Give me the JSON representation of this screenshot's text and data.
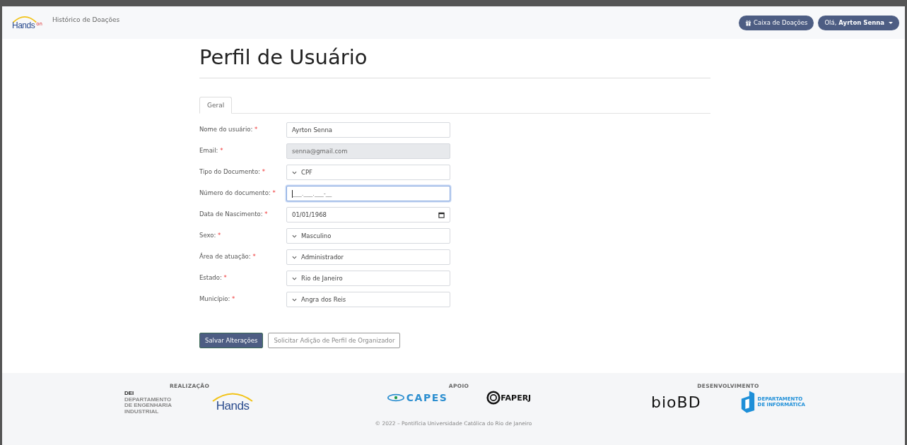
{
  "navbar": {
    "logo": {
      "text": "Hands",
      "sup": "on"
    },
    "links": [
      "Histórico de Doações"
    ],
    "donation_box_button": "Caixa de Doações",
    "user_menu": {
      "greeting": "Olá,",
      "name": "Ayrton Senna"
    }
  },
  "page_title": "Perfil de Usuário",
  "tabs": [
    {
      "label": "Geral",
      "selected": true
    }
  ],
  "form": {
    "required_mark": "*",
    "fields": [
      {
        "label": "Nome do usuário:",
        "kind": "text",
        "value": "Ayrton Senna",
        "disabled": false,
        "focused": false
      },
      {
        "label": "Email:",
        "kind": "text",
        "value": "senna@gmail.com",
        "disabled": true,
        "focused": false
      },
      {
        "label": "Tipo do Documento:",
        "kind": "select",
        "value": "CPF",
        "disabled": false,
        "focused": false
      },
      {
        "label": "Número do documento:",
        "kind": "text",
        "placeholder": "___.___.___-__",
        "disabled": false,
        "focused": true
      },
      {
        "label": "Data de Nascimento:",
        "kind": "date",
        "value": "01/01/1968",
        "disabled": false,
        "focused": false
      },
      {
        "label": "Sexo:",
        "kind": "select",
        "value": "Masculino",
        "disabled": false,
        "focused": false
      },
      {
        "label": "Área de atuação:",
        "kind": "select",
        "value": "Administrador",
        "disabled": false,
        "focused": false
      },
      {
        "label": "Estado:",
        "kind": "select",
        "value": "Rio de Janeiro",
        "disabled": false,
        "focused": false
      },
      {
        "label": "Município:",
        "kind": "select",
        "value": "Angra dos Reis",
        "disabled": false,
        "focused": false
      }
    ]
  },
  "buttons": [
    {
      "label": "Salvar Alterações",
      "kind": "primary"
    },
    {
      "label": "Solicitar Adição de Perfil de Organizador",
      "kind": "outline"
    }
  ],
  "footer": {
    "sections": [
      {
        "heading": "REALIZAÇÃO",
        "logos": [
          {
            "kind": "dei",
            "lines": [
              "DEI",
              "DEPARTAMENTO",
              "DE ENGENHARIA",
              "INDUSTRIAL"
            ]
          },
          {
            "kind": "hands",
            "lines": [
              "Hands"
            ]
          }
        ]
      },
      {
        "heading": "APOIO",
        "logos": [
          {
            "kind": "capes",
            "lines": [
              "CAPES"
            ]
          },
          {
            "kind": "faperj",
            "lines": [
              "FAPERJ"
            ]
          }
        ]
      },
      {
        "heading": "DESENVOLVIMENTO",
        "logos": [
          {
            "kind": "biobd",
            "lines": [
              "bioBD"
            ]
          },
          {
            "kind": "di",
            "lines": [
              "DEPARTAMENTO",
              "DE INFORMÁTICA"
            ]
          }
        ]
      }
    ],
    "copyright": "© 2022 – Pontifícia Universidade Católica do Rio de Janeiro"
  }
}
